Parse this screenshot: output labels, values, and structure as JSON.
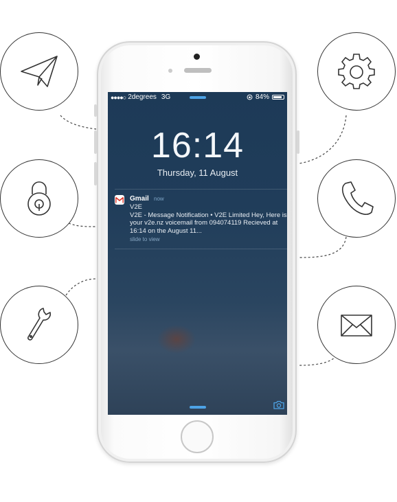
{
  "status_bar": {
    "signal": "●●●●○",
    "carrier": "2degrees",
    "network": "3G",
    "battery_percent": "84%"
  },
  "lock_screen": {
    "time": "16:14",
    "date": "Thursday, 11 August"
  },
  "notification": {
    "app_name": "Gmail",
    "time_ago": "now",
    "sender": "V2E",
    "body": "V2E - Message Notification  •  V2E Limited Hey, Here is your v2e.nz voicemail from 094074119 Recieved at 16:14 on the August 11...",
    "hint": "slide to view"
  },
  "feature_icons": {
    "left": [
      "paper-plane-icon",
      "padlock-icon",
      "wrench-icon"
    ],
    "right": [
      "gear-icon",
      "phone-icon",
      "envelope-icon"
    ]
  },
  "colors": {
    "accent": "#4da3e6",
    "outline": "#333333",
    "screen_bg": "#203d5a"
  }
}
